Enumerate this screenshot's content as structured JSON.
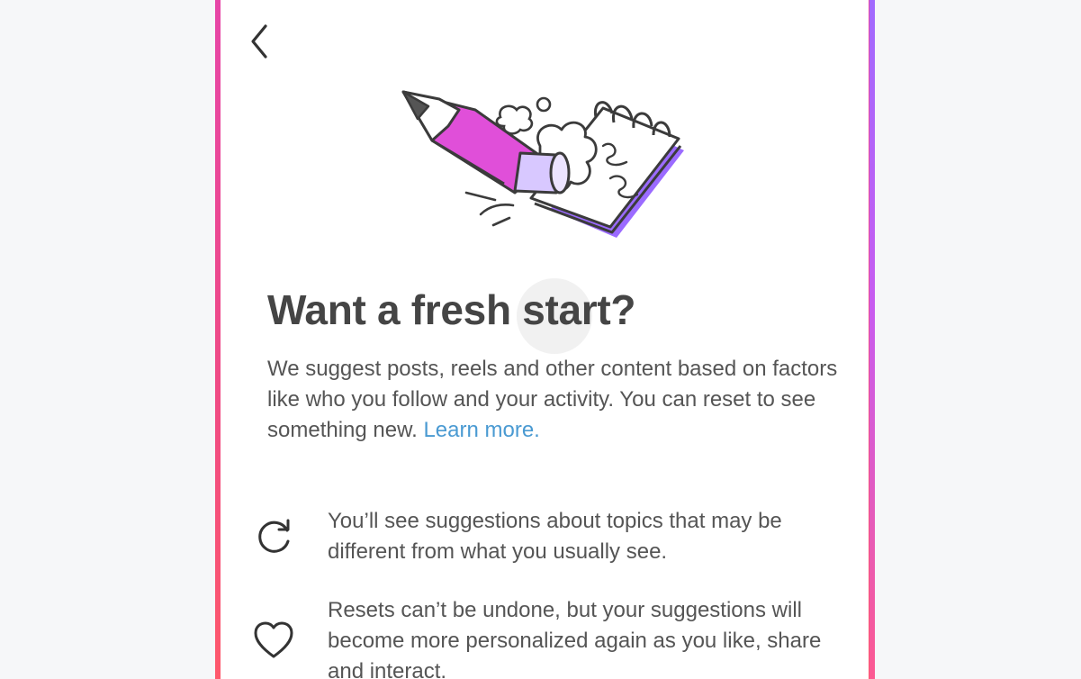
{
  "header": {
    "back_icon": "chevron-left-icon"
  },
  "hero": {
    "illustration": "pencil-eraser-notebook-illustration",
    "colors": {
      "pencil_body": "#e04fd9",
      "eraser": "#d8c8ff",
      "notebook_shadow": "#9b6bff",
      "outline": "#3b3b3b"
    }
  },
  "main": {
    "title": "Want a fresh start?",
    "description": "We suggest posts, reels and other content based on factors like who you follow and your activity. You can reset to see something new.",
    "learn_more": "Learn more."
  },
  "info": [
    {
      "icon": "refresh-icon",
      "text": "You’ll see suggestions about topics that may be different from what you usually see."
    },
    {
      "icon": "heart-icon",
      "text": "Resets can’t be undone, but your suggestions will become more personalized again as you like, share and interact."
    }
  ],
  "colors": {
    "link": "#4a9ad2",
    "text": "#555555",
    "title": "#454545",
    "frame_gradient_start": "#e646a9",
    "frame_gradient_end": "#ff5a6a"
  }
}
